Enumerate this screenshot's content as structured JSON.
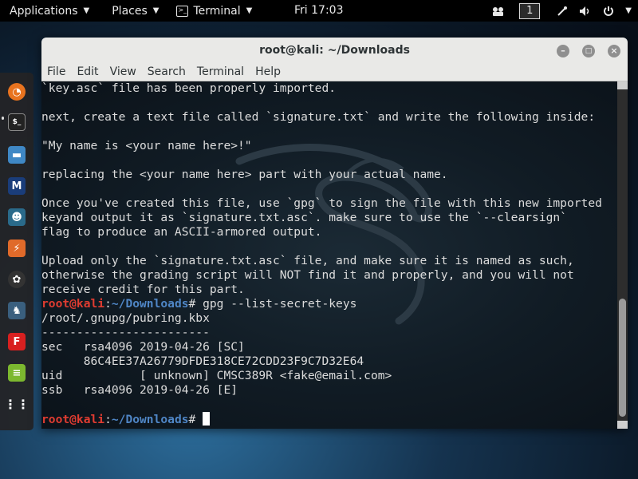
{
  "topbar": {
    "applications": "Applications",
    "places": "Places",
    "terminal": "Terminal",
    "clock": "Fri 17:03",
    "workspace": "1"
  },
  "window": {
    "title": "root@kali: ~/Downloads",
    "menu": [
      "File",
      "Edit",
      "View",
      "Search",
      "Terminal",
      "Help"
    ]
  },
  "terminal": {
    "lines": [
      "`key.asc` file has been properly imported.",
      "",
      "next, create a text file called `signature.txt` and write the following inside:",
      "",
      "\"My name is <your name here>!\"",
      "",
      "replacing the <your name here> part with your actual name.",
      "",
      "Once you've created this file, use `gpg` to sign the file with this new imported",
      "keyand output it as `signature.txt.asc`. make sure to use the `--clearsign`",
      "flag to produce an ASCII-armored output.",
      "",
      "Upload only the `signature.txt.asc` file, and make sure it is named as such,",
      "otherwise the grading script will NOT find it and properly, and you will not",
      "receive credit for this part."
    ],
    "prompt": {
      "user": "root@kali",
      "sep": ":",
      "path": "~/Downloads",
      "sym": "# "
    },
    "command": "gpg --list-secret-keys",
    "output": [
      "/root/.gnupg/pubring.kbx",
      "------------------------",
      "sec   rsa4096 2019-04-26 [SC]",
      "      86C4EE37A26779DFDE318CE72CDD23F9C7D32E64",
      "uid           [ unknown] CMSC389R <fake@email.com>",
      "ssb   rsa4096 2019-04-26 [E]",
      ""
    ]
  },
  "dock": {
    "items": [
      "firefox-icon",
      "terminal-icon",
      "files-icon",
      "metasploit-icon",
      "armitage-icon",
      "burpsuite-icon",
      "maltego-icon",
      "beef-icon",
      "faraday-icon",
      "leafpad-icon",
      "show-apps-icon"
    ]
  },
  "colors": {
    "prompt_user": "#e03c31",
    "prompt_path": "#4f86c6",
    "terminal_bg": "#111c25",
    "titlebar": "#e9e9e7"
  }
}
